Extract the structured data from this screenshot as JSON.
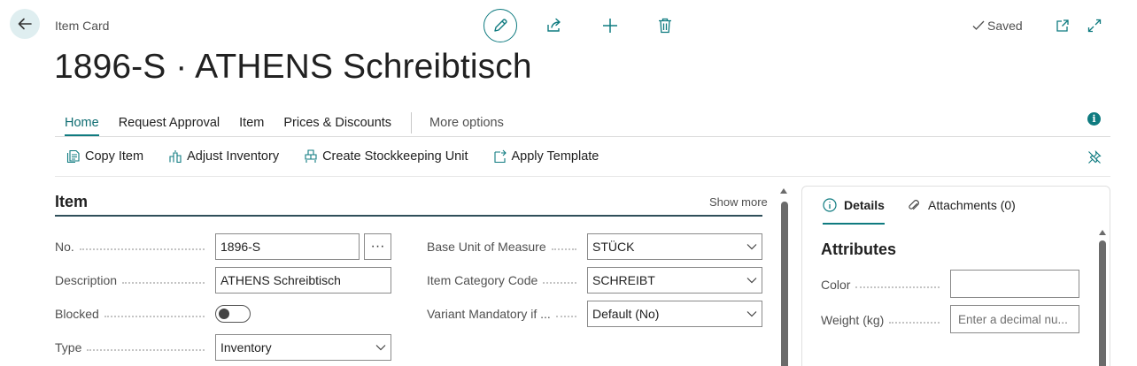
{
  "header": {
    "breadcrumb": "Item Card",
    "title": "1896-S · ATHENS Schreibtisch",
    "status": "Saved"
  },
  "tabs": [
    {
      "label": "Home",
      "active": true
    },
    {
      "label": "Request Approval"
    },
    {
      "label": "Item"
    },
    {
      "label": "Prices & Discounts"
    }
  ],
  "more_options": "More options",
  "actions": [
    {
      "label": "Copy Item",
      "icon": "copy-icon"
    },
    {
      "label": "Adjust Inventory",
      "icon": "adjust-inventory-icon"
    },
    {
      "label": "Create Stockkeeping Unit",
      "icon": "stockkeeping-icon"
    },
    {
      "label": "Apply Template",
      "icon": "template-icon"
    }
  ],
  "section": {
    "title": "Item",
    "show_more": "Show more"
  },
  "fields_left": {
    "no_label": "No.",
    "no_value": "1896-S",
    "description_label": "Description",
    "description_value": "ATHENS Schreibtisch",
    "blocked_label": "Blocked",
    "blocked_value": false,
    "type_label": "Type",
    "type_value": "Inventory"
  },
  "fields_right": {
    "base_uom_label": "Base Unit of Measure",
    "base_uom_value": "STÜCK",
    "category_label": "Item Category Code",
    "category_value": "SCHREIBT",
    "variant_label": "Variant Mandatory if ...",
    "variant_value": "Default (No)"
  },
  "factbox": {
    "tab_details": "Details",
    "tab_attachments": "Attachments (0)",
    "title": "Attributes",
    "color_label": "Color",
    "color_value": "",
    "weight_label": "Weight (kg)",
    "weight_placeholder": "Enter a decimal nu..."
  },
  "colors": {
    "accent": "#0f7b80",
    "text": "#212121",
    "muted": "#505050"
  }
}
